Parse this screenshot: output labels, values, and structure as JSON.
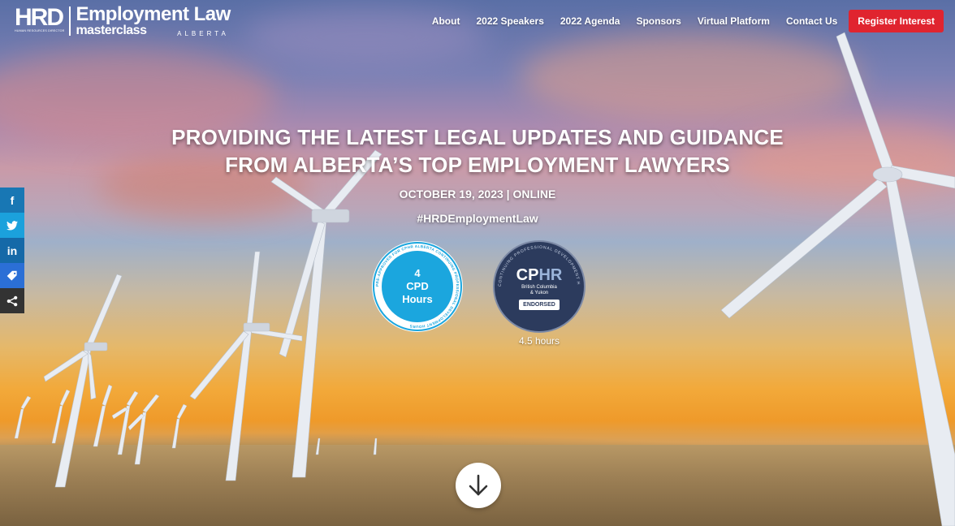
{
  "brand": {
    "hrd": "HRD",
    "hrd_sub": "HUMAN RESOURCES DIRECTOR",
    "title": "Employment Law",
    "subtitle": "masterclass",
    "region": "ALBERTA"
  },
  "nav": {
    "items": [
      {
        "label": "About"
      },
      {
        "label": "2022 Speakers"
      },
      {
        "label": "2022 Agenda"
      },
      {
        "label": "Sponsors"
      },
      {
        "label": "Virtual Platform"
      },
      {
        "label": "Contact Us"
      }
    ],
    "register_label": "Register Interest"
  },
  "hero": {
    "headline_line1": "PROVIDING THE LATEST LEGAL UPDATES AND GUIDANCE",
    "headline_line2": "FROM ALBERTA’S TOP EMPLOYMENT LAWYERS",
    "date": "OCTOBER 19, 2023 | ONLINE",
    "hashtag": "#HRDEmploymentLaw"
  },
  "badges": {
    "cpd": {
      "hours": "4",
      "line1": "CPD",
      "line2": "Hours",
      "ring_text": "PRE-APPROVED FOR CPHR ALBERTA CONTINUING PROFESSIONAL DEVELOPMENT HOURS"
    },
    "cphr": {
      "ring_text": "CONTINUING PROFESSIONAL DEVELOPMENT HOURS",
      "logo_cp": "CP",
      "logo_hr": "HR",
      "sub_line1": "British Columbia",
      "sub_line2": "& Yukon",
      "endorsed": "ENDORSED",
      "hours_caption": "4.5 hours"
    }
  },
  "share": {
    "items": [
      {
        "icon": "facebook-icon",
        "glyph": "f"
      },
      {
        "icon": "twitter-icon",
        "glyph": "t"
      },
      {
        "icon": "linkedin-icon",
        "glyph": "in"
      },
      {
        "icon": "tag-icon",
        "glyph": "⬥"
      },
      {
        "icon": "share-icon",
        "glyph": "∴"
      }
    ]
  },
  "colors": {
    "register": "#e0242f",
    "cpd_blue": "#1ba6de",
    "cphr_navy": "#2c3b5d"
  }
}
